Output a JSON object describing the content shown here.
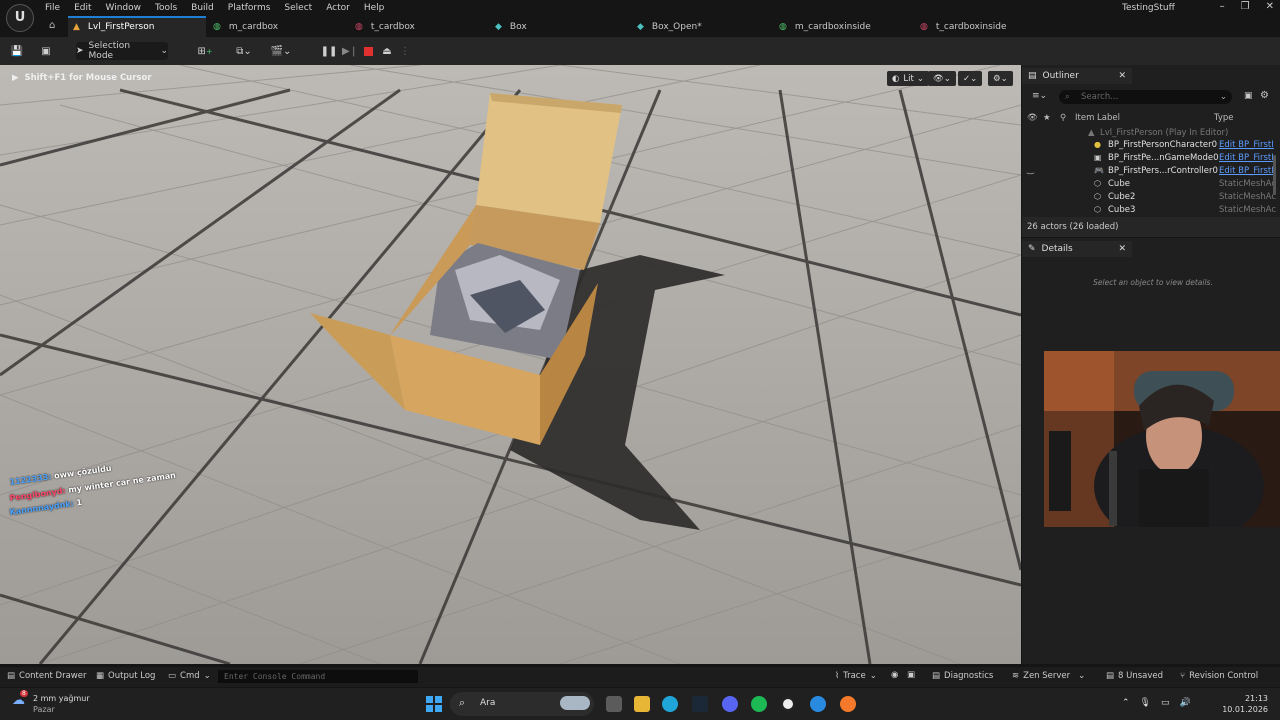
{
  "menu": {
    "items": [
      "File",
      "Edit",
      "Window",
      "Tools",
      "Build",
      "Platforms",
      "Select",
      "Actor",
      "Help"
    ],
    "project": "TestingStuff"
  },
  "tabs": [
    {
      "label": "Lvl_FirstPerson",
      "icon": "level-icon"
    },
    {
      "label": "m_cardbox",
      "icon": "material-icon"
    },
    {
      "label": "t_cardbox",
      "icon": "texture-icon"
    },
    {
      "label": "Box",
      "icon": "mesh-icon"
    },
    {
      "label": "Box_Open*",
      "icon": "mesh-icon"
    },
    {
      "label": "m_cardboxinside",
      "icon": "material-icon"
    },
    {
      "label": "t_cardboxinside",
      "icon": "texture-icon"
    }
  ],
  "toolbar": {
    "selection_mode": "Selection Mode"
  },
  "viewport": {
    "hint": "Shift+F1 for Mouse Cursor",
    "view_mode": "Lit",
    "chat": [
      {
        "user": "1122333:",
        "msg": "oww çözuldu",
        "color": "#4aa3ff"
      },
      {
        "user": "Pengibonyd:",
        "msg": "my winter car ne zaman",
        "color": "#ff4a6a"
      },
      {
        "user": "Kannnnaydnk:",
        "msg": "1",
        "color": "#4aa3ff"
      }
    ]
  },
  "outliner": {
    "title": "Outliner",
    "search_placeholder": "Search...",
    "col_label": "Item Label",
    "col_type": "Type",
    "root": "Lvl_FirstPerson (Play In Editor)",
    "rows": [
      {
        "label": "BP_FirstPersonCharacter0",
        "type": "Edit BP_FirstI",
        "link": true,
        "icon": "character-icon"
      },
      {
        "label": "BP_FirstPe...nGameMode0",
        "type": "Edit BP_FirstI",
        "link": true,
        "icon": "gamemode-icon"
      },
      {
        "label": "BP_FirstPers...rController0",
        "type": "Edit BP_FirstI",
        "link": true,
        "icon": "controller-icon"
      },
      {
        "label": "Cube",
        "type": "StaticMeshAc",
        "link": false,
        "icon": "mesh-icon"
      },
      {
        "label": "Cube2",
        "type": "StaticMeshAc",
        "link": false,
        "icon": "mesh-icon"
      },
      {
        "label": "Cube3",
        "type": "StaticMeshAc",
        "link": false,
        "icon": "mesh-icon"
      }
    ],
    "count": "26 actors (26 loaded)"
  },
  "details": {
    "title": "Details",
    "empty": "Select an object to view details."
  },
  "statusbar": {
    "content_drawer": "Content Drawer",
    "output_log": "Output Log",
    "cmd": "Cmd",
    "console_placeholder": "Enter Console Command",
    "trace": "Trace",
    "diagnostics": "Diagnostics",
    "zen": "Zen Server",
    "unsaved": "8 Unsaved",
    "revision": "Revision Control"
  },
  "taskbar": {
    "weather_badge": "8",
    "weather_temp": "2 mm yağmur",
    "weather_day": "Pazar",
    "search": "Ara",
    "time": "21:13",
    "date": "10.01.2026"
  },
  "colors": {
    "accent": "#1f7fd4",
    "link": "#5b9bff"
  }
}
